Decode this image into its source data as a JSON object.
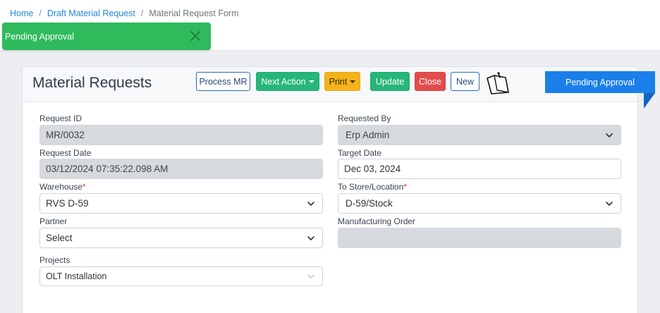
{
  "breadcrumb": {
    "home": "Home",
    "draft": "Draft Material Request",
    "current": "Material Request Form",
    "separator": "/"
  },
  "toast": {
    "message": "Pending Approval"
  },
  "card": {
    "title": "Material Requests"
  },
  "toolbar": {
    "process_mr": "Process MR",
    "next_action": "Next Action",
    "print": "Print",
    "update": "Update",
    "close": "Close",
    "new": "New"
  },
  "status_ribbon": "Pending Approval",
  "form": {
    "request_id": {
      "label": "Request ID",
      "value": "MR/0032"
    },
    "requested_by": {
      "label": "Requested By",
      "value": "Erp Admin"
    },
    "request_date": {
      "label": "Request Date",
      "value": "03/12/2024 07:35:22.098 AM"
    },
    "target_date": {
      "label": "Target Date",
      "value": "Dec 03, 2024"
    },
    "warehouse": {
      "label": "Warehouse",
      "required_mark": "*",
      "value": "RVS D-59"
    },
    "to_store": {
      "label": "To Store/Location",
      "required_mark": "*",
      "value": "D-59/Stock"
    },
    "partner": {
      "label": "Partner",
      "value": "Select"
    },
    "manufacturing_order": {
      "label": "Manufacturing Order",
      "value": ""
    },
    "projects": {
      "label": "Projects",
      "value": "OLT Installation"
    }
  },
  "colors": {
    "toast_bg": "#2fbb5c",
    "ribbon_bg": "#1a7fe8",
    "btn_green": "#27b67a",
    "btn_yellow": "#f6b21a",
    "btn_red": "#e24c4c",
    "link": "#1e88d8"
  },
  "icons": {
    "toast_close": "close-icon",
    "note": "sticky-note-icon",
    "select_arrow": "chevron-down-icon"
  }
}
